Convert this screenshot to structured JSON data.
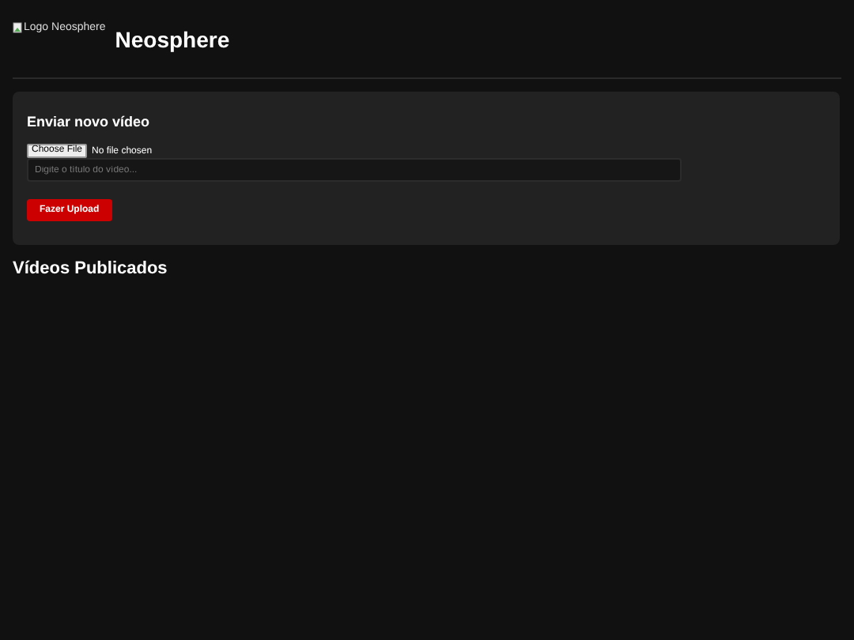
{
  "header": {
    "logo_alt": "Logo Neosphere",
    "title": "Neosphere"
  },
  "upload_card": {
    "title": "Enviar novo vídeo",
    "file_button": "Choose File",
    "file_status": "No file chosen",
    "title_field": {
      "placeholder": "Digite o título do vídeo..."
    },
    "submit_button": "Fazer Upload"
  },
  "videos_section": {
    "title": "Vídeos Publicados"
  }
}
